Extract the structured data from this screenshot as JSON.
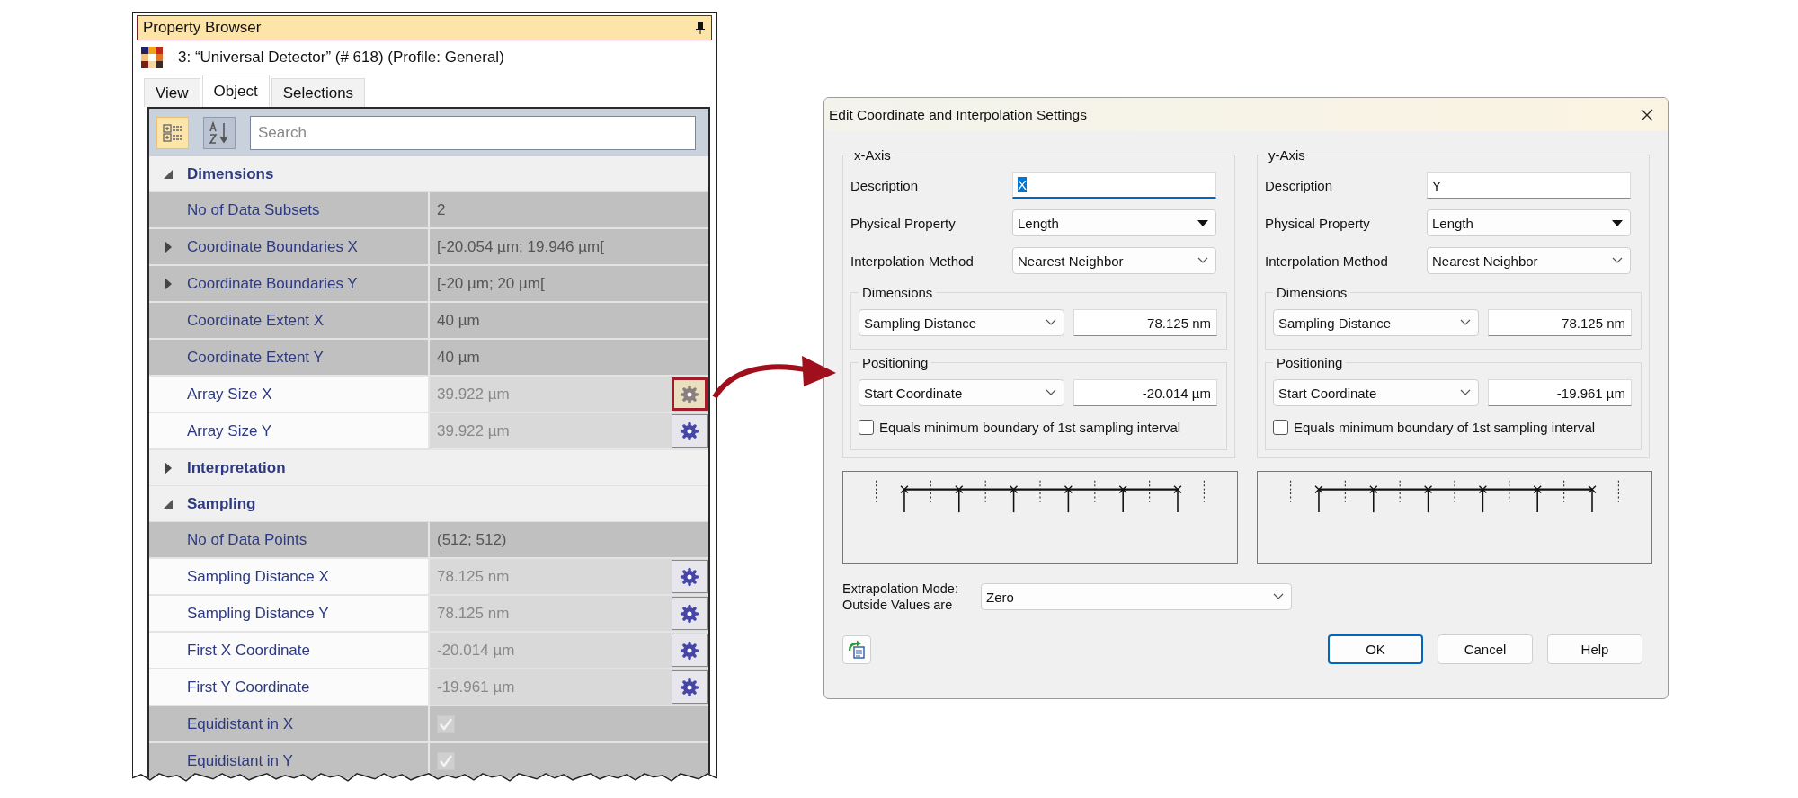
{
  "panel": {
    "title": "Property Browser",
    "object_label": "3: “Universal Detector” (# 618) (Profile: General)",
    "tabs": [
      {
        "label": "View",
        "selected": false
      },
      {
        "label": "Object",
        "selected": true
      },
      {
        "label": "Selections",
        "selected": false
      }
    ],
    "toolbar": [
      {
        "kind": "categorized",
        "selected": true
      },
      {
        "kind": "alphabetical",
        "selected": false
      }
    ],
    "search": {
      "placeholder": "Search"
    },
    "groups": [
      {
        "label": "Dimensions",
        "expanded": true,
        "rows": [
          {
            "label": "No of Data Subsets",
            "value": "2",
            "kind": "text",
            "editable": false
          },
          {
            "label": "Coordinate Boundaries X",
            "value": "[-20.054 µm; 19.946 µm[",
            "kind": "text",
            "editable": false,
            "expanded": false
          },
          {
            "label": "Coordinate Boundaries Y",
            "value": "[-20 µm; 20 µm[",
            "kind": "text",
            "editable": false,
            "expanded": false
          },
          {
            "label": "Coordinate Extent X",
            "value": "40 µm",
            "kind": "text",
            "editable": false
          },
          {
            "label": "Coordinate Extent Y",
            "value": "40 µm",
            "kind": "text",
            "editable": false
          },
          {
            "label": "Array Size X",
            "value": "39.922 µm",
            "kind": "text",
            "editable": true,
            "highlighted": true
          },
          {
            "label": "Array Size Y",
            "value": "39.922 µm",
            "kind": "text",
            "editable": true,
            "highlighted": false
          }
        ]
      },
      {
        "label": "Interpretation",
        "expanded": false
      },
      {
        "label": "Sampling",
        "expanded": true,
        "rows": [
          {
            "label": "No of Data Points",
            "value": "(512; 512)",
            "kind": "text",
            "editable": false
          },
          {
            "label": "Sampling Distance X",
            "value": "78.125 nm",
            "kind": "text",
            "editable": true,
            "highlighted": false
          },
          {
            "label": "Sampling Distance Y",
            "value": "78.125 nm",
            "kind": "text",
            "editable": true,
            "highlighted": false
          },
          {
            "label": "First X Coordinate",
            "value": "-20.014 µm",
            "kind": "text",
            "editable": true,
            "highlighted": false
          },
          {
            "label": "First Y Coordinate",
            "value": "-19.961 µm",
            "kind": "text",
            "editable": true,
            "highlighted": false
          },
          {
            "label": "Equidistant in X",
            "kind": "check",
            "checked": true,
            "editable": false
          },
          {
            "label": "Equidistant in Y",
            "kind": "check",
            "checked": true,
            "editable": false
          }
        ]
      }
    ]
  },
  "dialog": {
    "title": "Edit Coordinate and Interpolation Settings",
    "axes": [
      {
        "title": "x-Axis",
        "description": {
          "label": "Description",
          "value": "X",
          "focused": true
        },
        "physical_property": {
          "label": "Physical Property",
          "value": "Length"
        },
        "interpolation": {
          "label": "Interpolation Method",
          "value": "Nearest Neighbor"
        },
        "dimensions": {
          "title": "Dimensions",
          "mode": "Sampling Distance",
          "value": "78.125 nm"
        },
        "positioning": {
          "title": "Positioning",
          "mode": "Start Coordinate",
          "value": "-20.014 µm",
          "checkbox": {
            "label": "Equals minimum boundary of 1st sampling interval",
            "checked": false
          }
        }
      },
      {
        "title": "y-Axis",
        "description": {
          "label": "Description",
          "value": "Y",
          "focused": false
        },
        "physical_property": {
          "label": "Physical Property",
          "value": "Length"
        },
        "interpolation": {
          "label": "Interpolation Method",
          "value": "Nearest Neighbor"
        },
        "dimensions": {
          "title": "Dimensions",
          "mode": "Sampling Distance",
          "value": "78.125 nm"
        },
        "positioning": {
          "title": "Positioning",
          "mode": "Start Coordinate",
          "value": "-19.961 µm",
          "checkbox": {
            "label": "Equals minimum boundary of 1st sampling interval",
            "checked": false
          }
        }
      }
    ],
    "extrapolation": {
      "label": "Extrapolation Mode:\nOutside Values are",
      "value": "Zero"
    },
    "buttons": [
      {
        "label": "OK",
        "default": true
      },
      {
        "label": "Cancel",
        "default": false
      },
      {
        "label": "Help",
        "default": false
      }
    ]
  }
}
